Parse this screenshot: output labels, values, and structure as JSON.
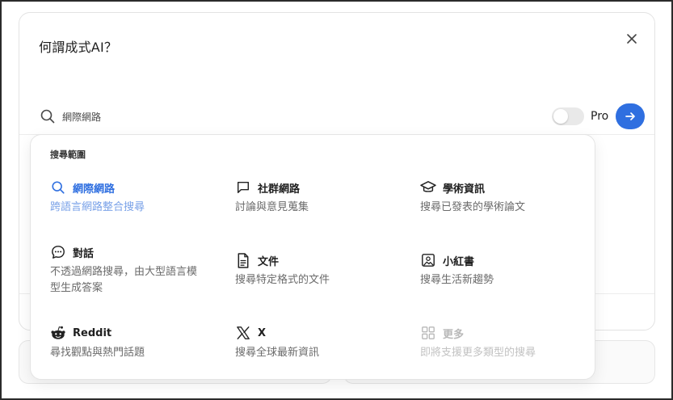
{
  "query": "何謂成式AI？",
  "search_bar": {
    "source_label": "網際網路",
    "pro_label": "Pro"
  },
  "dropdown": {
    "title": "搜尋範圍",
    "options": [
      {
        "icon": "search-icon",
        "title": "網際網路",
        "desc": "跨語言網路整合搜尋",
        "state": "active"
      },
      {
        "icon": "chat-square-icon",
        "title": "社群網路",
        "desc": "討論與意見蒐集",
        "state": "normal"
      },
      {
        "icon": "graduation-cap-icon",
        "title": "學術資訊",
        "desc": "搜尋已發表的學術論文",
        "state": "normal"
      },
      {
        "icon": "chat-bubble-icon",
        "title": "對話",
        "desc": "不透過網路搜尋，由大型語言模型生成答案",
        "state": "normal"
      },
      {
        "icon": "document-icon",
        "title": "文件",
        "desc": "搜尋特定格式的文件",
        "state": "normal"
      },
      {
        "icon": "image-icon",
        "title": "小紅書",
        "desc": "搜尋生活新趨勢",
        "state": "normal"
      },
      {
        "icon": "reddit-icon",
        "title": "Reddit",
        "desc": "尋找觀點與熱門話題",
        "state": "normal"
      },
      {
        "icon": "x-logo-icon",
        "title": "X",
        "desc": "搜尋全球最新資訊",
        "state": "normal"
      },
      {
        "icon": "grid-icon",
        "title": "更多",
        "desc": "即將支援更多類型的搜尋",
        "state": "disabled"
      }
    ]
  },
  "colors": {
    "accent": "#2f6fe0",
    "accent_light": "#7aa2e8",
    "disabled": "#b8b8b8"
  }
}
